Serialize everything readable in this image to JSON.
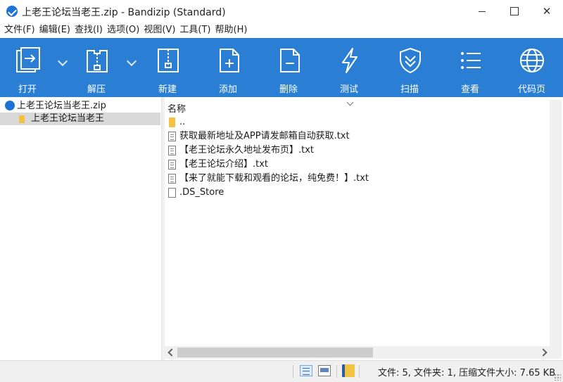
{
  "window": {
    "title": "上老王论坛当老王.zip - Bandizip (Standard)"
  },
  "menu": [
    "文件(F)",
    "编辑(E)",
    "查找(I)",
    "选项(O)",
    "视图(V)",
    "工具(T)",
    "帮助(H)"
  ],
  "toolbar": {
    "open": "打开",
    "extract": "解压",
    "new": "新建",
    "add": "添加",
    "delete": "删除",
    "test": "测试",
    "scan": "扫描",
    "view": "查看",
    "codepage": "代码页"
  },
  "tree": {
    "root": "上老王论坛当老王.zip",
    "child": "上老王论坛当老王"
  },
  "filelist": {
    "column_name": "名称",
    "files": [
      {
        "name": "..",
        "type": "folder"
      },
      {
        "name": "获取最新地址及APP请发邮箱自动获取.txt",
        "type": "txt"
      },
      {
        "name": "【老王论坛永久地址发布页】.txt",
        "type": "txt"
      },
      {
        "name": "【老王论坛介绍】.txt",
        "type": "txt"
      },
      {
        "name": "【来了就能下载和观看的论坛，纯免费！】.txt",
        "type": "txt"
      },
      {
        "name": ".DS_Store",
        "type": "file"
      }
    ]
  },
  "status": {
    "text": "文件: 5, 文件夹: 1, 压缩文件大小: 7.65 KB"
  },
  "colors": {
    "toolbar_bg": "#2a7fd5",
    "selection_bg": "#d9d9d9",
    "folder": "#f4c243"
  }
}
